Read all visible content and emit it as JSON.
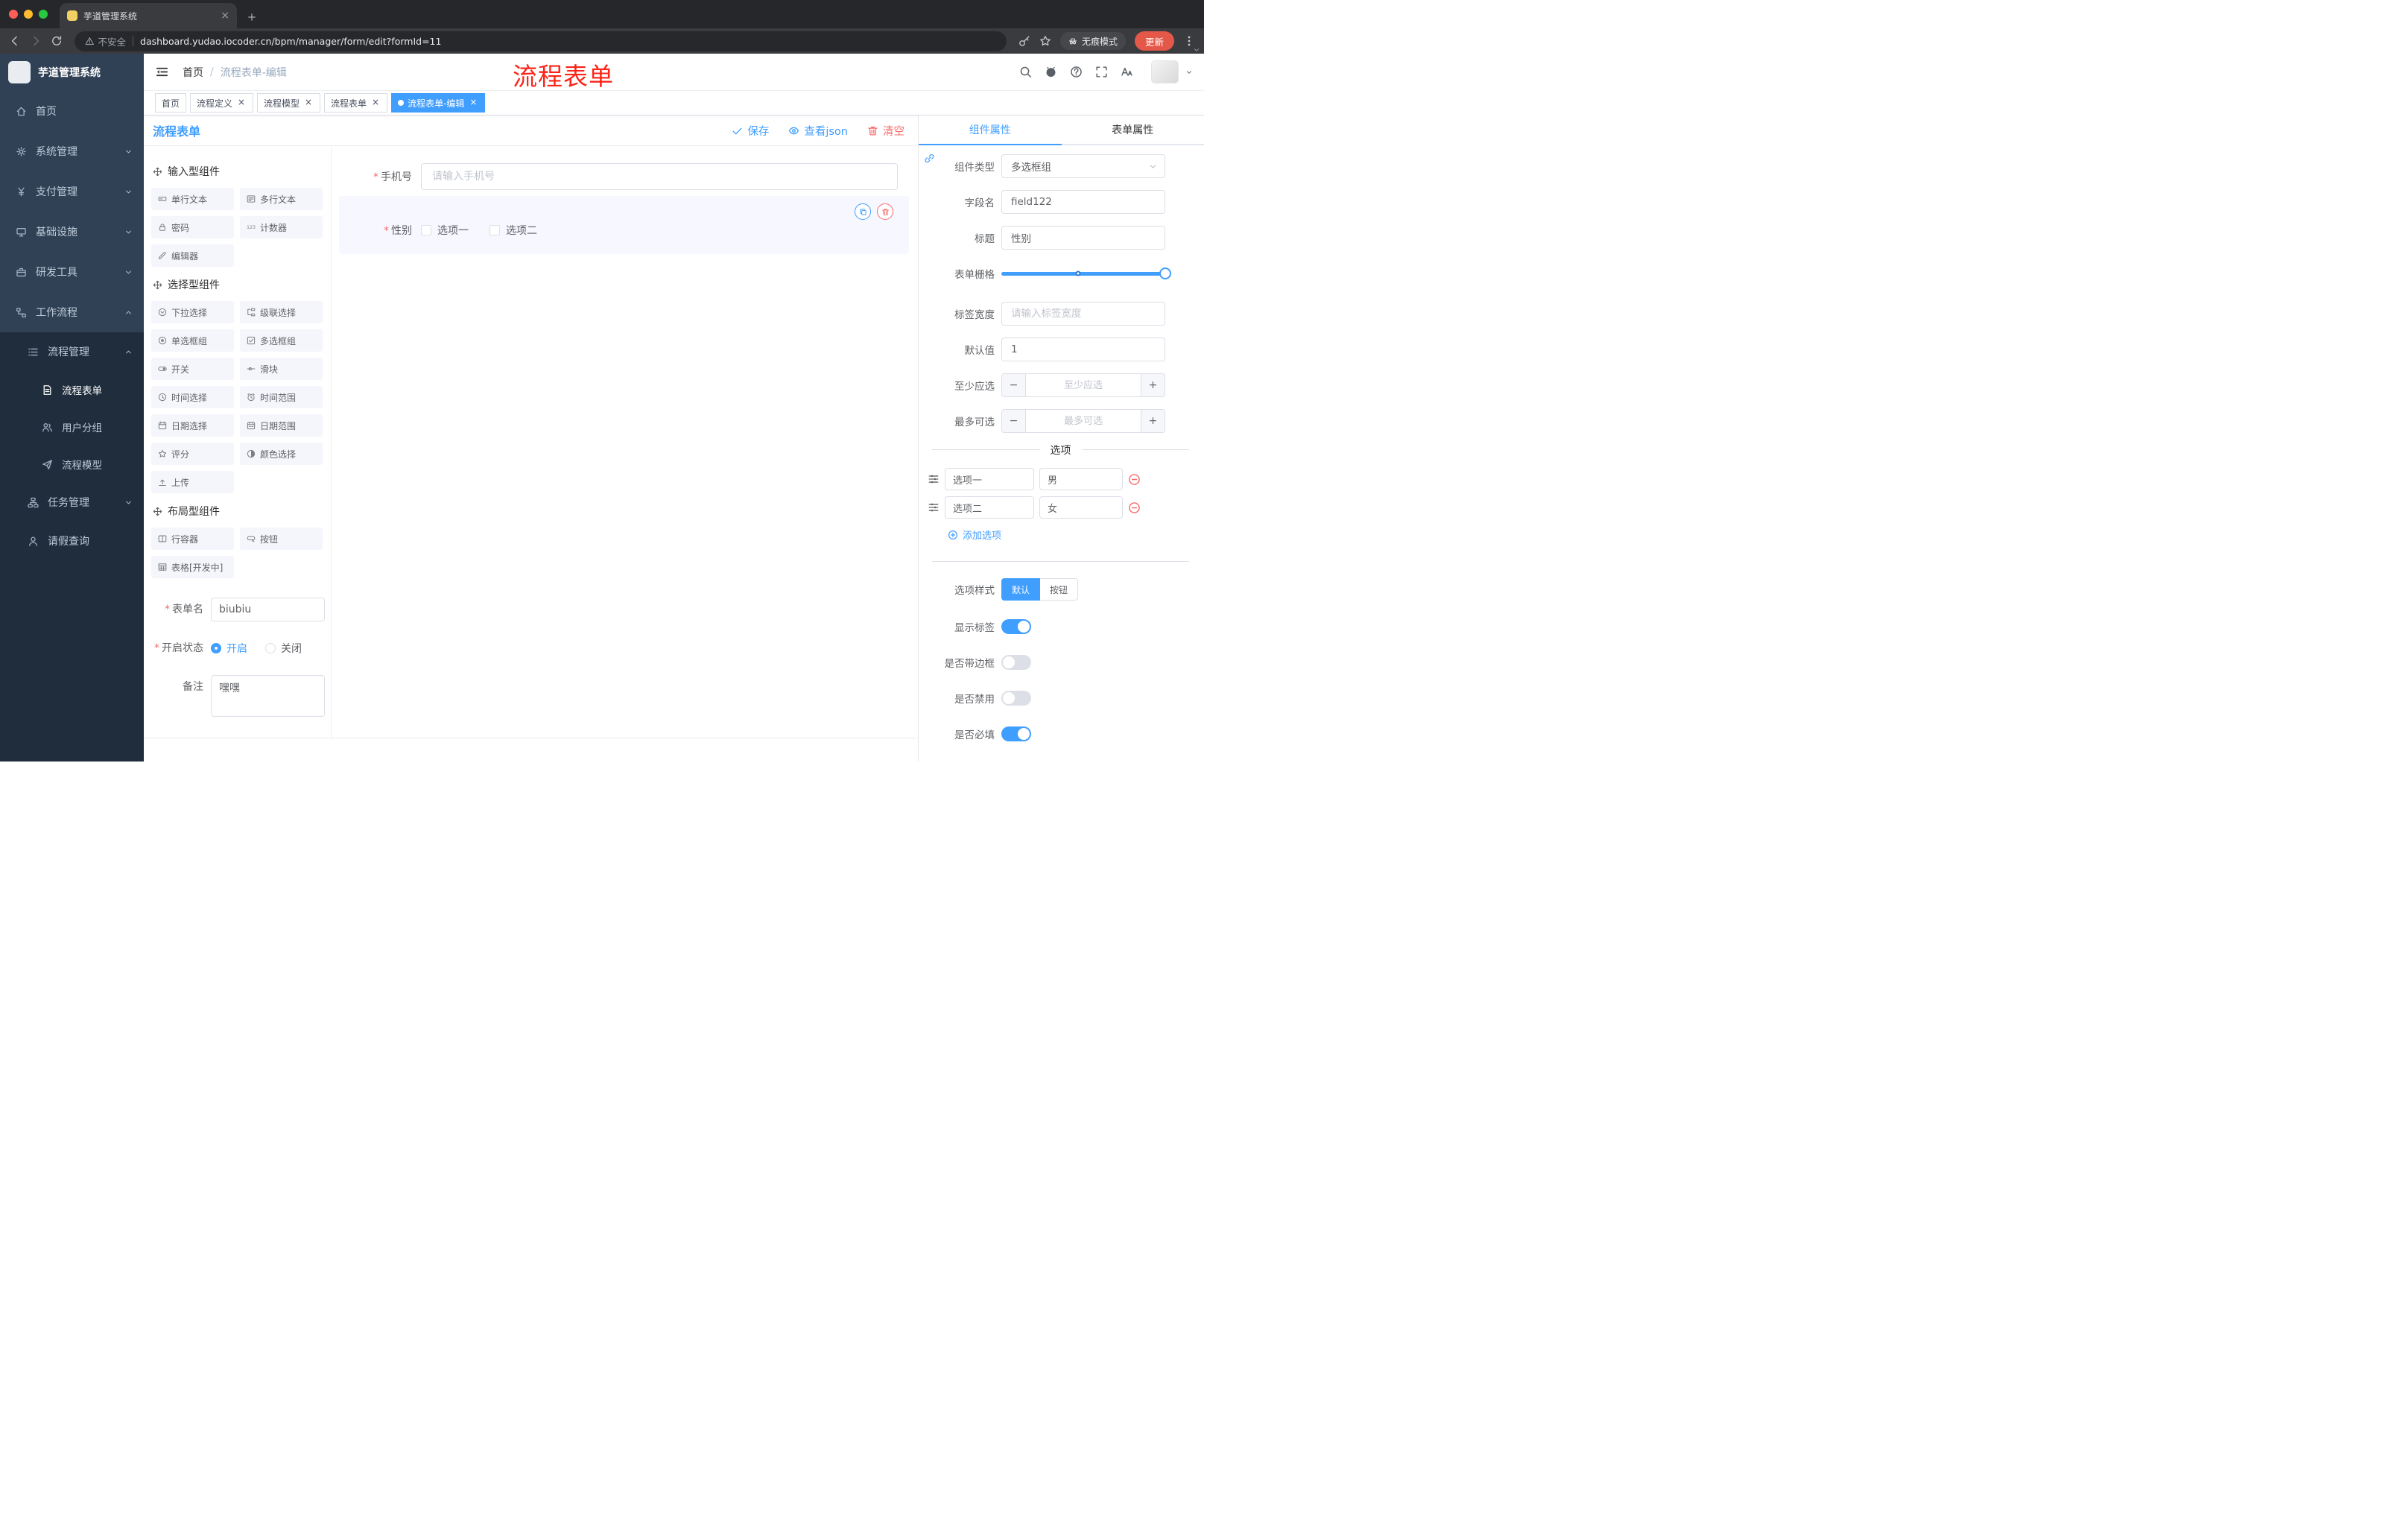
{
  "annotation": {
    "text": "流程表单",
    "color": "#fc2419"
  },
  "colors": {
    "primary": "#409eff",
    "danger": "#f56c6c",
    "sidebar_bg": "#304156",
    "submenu_bg": "#1f2d3d",
    "update_button": "#e4584a"
  },
  "browser": {
    "tab": {
      "title": "芋道管理系统"
    },
    "nav_icons": [
      "aleft",
      "aright",
      "reload"
    ],
    "address": {
      "security": "不安全",
      "url": "dashboard.yudao.iocoder.cn/bpm/manager/form/edit?formId=11"
    },
    "incognito_label": "无痕模式",
    "update_label": "更新"
  },
  "sidebar": {
    "title": "芋道管理系统",
    "menu": [
      {
        "key": "home",
        "label": "首页",
        "icon": "home",
        "arrow": null
      },
      {
        "key": "system",
        "label": "系统管理",
        "icon": "gear",
        "arrow": "down"
      },
      {
        "key": "payment",
        "label": "支付管理",
        "icon": "yen",
        "arrow": "down"
      },
      {
        "key": "infrastructure",
        "label": "基础设施",
        "icon": "monitor",
        "arrow": "down"
      },
      {
        "key": "dev-tools",
        "label": "研发工具",
        "icon": "suitcase",
        "arrow": "down"
      },
      {
        "key": "workflow",
        "label": "工作流程",
        "icon": "flow",
        "arrow": "up"
      }
    ],
    "submenu": [
      {
        "key": "process-mgmt",
        "label": "流程管理",
        "icon": "list",
        "arrow": "up",
        "level": 1
      },
      {
        "key": "process-form",
        "label": "流程表单",
        "icon": "doc",
        "level": 2,
        "active": true
      },
      {
        "key": "user-group",
        "label": "用户分组",
        "icon": "users",
        "level": 2
      },
      {
        "key": "process-model",
        "label": "流程模型",
        "icon": "send",
        "level": 2
      },
      {
        "key": "task-mgmt",
        "label": "任务管理",
        "icon": "tree",
        "arrow": "down",
        "level": 1
      },
      {
        "key": "leave-query",
        "label": "请假查询",
        "icon": "person",
        "level": 1
      }
    ]
  },
  "navbar": {
    "breadcrumb": [
      "首页",
      "流程表单-编辑"
    ],
    "icons": [
      "search",
      "github",
      "question",
      "full",
      "fontsize"
    ]
  },
  "tags": [
    {
      "key": "home",
      "label": "首页",
      "closable": false,
      "active": false
    },
    {
      "key": "process-definition",
      "label": "流程定义",
      "closable": true,
      "active": false
    },
    {
      "key": "process-model",
      "label": "流程模型",
      "closable": true,
      "active": false
    },
    {
      "key": "process-form",
      "label": "流程表单",
      "closable": true,
      "active": false
    },
    {
      "key": "process-form-edit",
      "label": "流程表单-编辑",
      "closable": true,
      "active": true
    }
  ],
  "designer": {
    "title": "流程表单",
    "actions": [
      {
        "key": "save",
        "label": "保存",
        "icon": "check",
        "color": "#409eff"
      },
      {
        "key": "view-json",
        "label": "查看json",
        "icon": "eye",
        "color": "#409eff"
      },
      {
        "key": "clear",
        "label": "清空",
        "icon": "trash",
        "color": "#f56c6c"
      }
    ]
  },
  "components": {
    "groups": [
      {
        "title": "输入型组件",
        "items": [
          {
            "key": "input-single",
            "label": "单行文本",
            "icon": "textline"
          },
          {
            "key": "input-multi",
            "label": "多行文本",
            "icon": "textarea"
          },
          {
            "key": "password",
            "label": "密码",
            "icon": "lock"
          },
          {
            "key": "counter",
            "label": "计数器",
            "icon": "counter"
          },
          {
            "key": "editor",
            "label": "编辑器",
            "icon": "editor"
          }
        ]
      },
      {
        "title": "选择型组件",
        "items": [
          {
            "key": "select",
            "label": "下拉选择",
            "icon": "select"
          },
          {
            "key": "cascader",
            "label": "级联选择",
            "icon": "cascader"
          },
          {
            "key": "radio-group",
            "label": "单选框组",
            "icon": "radio"
          },
          {
            "key": "checkbox-group",
            "label": "多选框组",
            "icon": "checksq"
          },
          {
            "key": "switch",
            "label": "开关",
            "icon": "switch"
          },
          {
            "key": "slider",
            "label": "滑块",
            "icon": "slideric"
          },
          {
            "key": "time-picker",
            "label": "时间选择",
            "icon": "clock"
          },
          {
            "key": "time-range",
            "label": "时间范围",
            "icon": "timerange"
          },
          {
            "key": "date-picker",
            "label": "日期选择",
            "icon": "calendar"
          },
          {
            "key": "date-range",
            "label": "日期范围",
            "icon": "daterange"
          },
          {
            "key": "rate",
            "label": "评分",
            "icon": "starb"
          },
          {
            "key": "color-picker",
            "label": "颜色选择",
            "icon": "colorw"
          },
          {
            "key": "upload",
            "label": "上传",
            "icon": "upload"
          }
        ]
      },
      {
        "title": "布局型组件",
        "items": [
          {
            "key": "row-container",
            "label": "行容器",
            "icon": "rowbox"
          },
          {
            "key": "button",
            "label": "按钮",
            "icon": "buttonic"
          },
          {
            "key": "table",
            "label": "表格[开发中]",
            "icon": "tableic"
          }
        ]
      }
    ],
    "meta": {
      "form_name": {
        "label": "表单名",
        "required": true,
        "value": "biubiu"
      },
      "status": {
        "label": "开启状态",
        "required": true,
        "options": [
          {
            "label": "开启",
            "selected": true
          },
          {
            "label": "关闭",
            "selected": false
          }
        ]
      },
      "remark": {
        "label": "备注",
        "value": "嘿嘿"
      }
    }
  },
  "canvas": {
    "phone": {
      "label": "手机号",
      "required": true,
      "placeholder": "请输入手机号"
    },
    "gender": {
      "label": "性别",
      "required": true,
      "options": [
        "选项一",
        "选项二"
      ]
    }
  },
  "props": {
    "tabs": [
      {
        "key": "component-props",
        "label": "组件属性",
        "active": true
      },
      {
        "key": "form-props",
        "label": "表单属性",
        "active": false
      }
    ],
    "fields": {
      "type": {
        "label": "组件类型",
        "value": "多选框组"
      },
      "field": {
        "label": "字段名",
        "value": "field122"
      },
      "title": {
        "label": "标题",
        "value": "性别"
      },
      "grid": {
        "label": "表单栅格"
      },
      "label_width": {
        "label": "标签宽度",
        "placeholder": "请输入标签宽度"
      },
      "default": {
        "label": "默认值",
        "value": "1"
      },
      "min": {
        "label": "至少应选",
        "placeholder": "至少应选"
      },
      "max": {
        "label": "最多可选",
        "placeholder": "最多可选"
      }
    },
    "options": {
      "title": "选项",
      "rows": [
        {
          "label": "选项一",
          "value": "男"
        },
        {
          "label": "选项二",
          "value": "女"
        }
      ],
      "add_label": "添加选项"
    },
    "style": {
      "label": "选项样式",
      "buttons": [
        {
          "key": "default",
          "label": "默认",
          "active": true
        },
        {
          "key": "button",
          "label": "按钮",
          "active": false
        }
      ]
    },
    "switches": [
      {
        "key": "show-label",
        "label": "显示标签",
        "on": true
      },
      {
        "key": "border",
        "label": "是否带边框",
        "on": false
      },
      {
        "key": "disabled",
        "label": "是否禁用",
        "on": false
      },
      {
        "key": "required",
        "label": "是否必填",
        "on": true
      }
    ]
  }
}
